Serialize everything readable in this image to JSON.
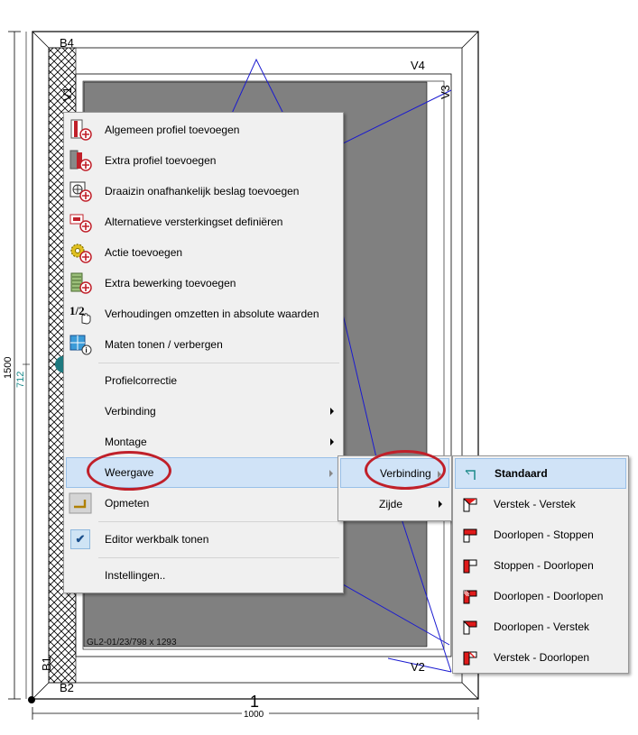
{
  "window_info": {
    "size_label": "GL2-01/23/798 x 1293",
    "corner_labels": {
      "b4": "B4",
      "b2": "B2",
      "b1": "B1",
      "v1": "V1",
      "v2": "V2",
      "v3": "V3",
      "v4": "V4"
    },
    "frame_number": "1"
  },
  "dimensions": {
    "height": "1500",
    "height_sub": "712",
    "width": "1000"
  },
  "context_menu": {
    "items": [
      {
        "label": "Algemeen profiel toevoegen",
        "icon": "profile-add-icon"
      },
      {
        "label": "Extra profiel toevoegen",
        "icon": "extra-profile-add-icon"
      },
      {
        "label": "Draaizin onafhankelijk beslag toevoegen",
        "icon": "hardware-add-icon"
      },
      {
        "label": "Alternatieve versterkingset definiëren",
        "icon": "reinforcement-icon"
      },
      {
        "label": "Actie toevoegen",
        "icon": "action-gear-icon"
      },
      {
        "label": "Extra bewerking toevoegen",
        "icon": "machining-add-icon"
      },
      {
        "label": "Verhoudingen omzetten in absolute waarden",
        "icon": "ratio-hand-icon"
      },
      {
        "label": "Maten tonen / verbergen",
        "icon": "dimensions-toggle-icon"
      },
      {
        "label": "Profielcorrectie"
      },
      {
        "label": "Verbinding"
      },
      {
        "label": "Montage"
      },
      {
        "label": "Weergave"
      },
      {
        "label": "Opmeten",
        "icon": "measure-icon"
      },
      {
        "label": "Editor werkbalk tonen",
        "checked": true
      },
      {
        "label": "Instellingen.."
      }
    ]
  },
  "submenu_weergave": {
    "items": [
      {
        "label": "Verbinding"
      },
      {
        "label": "Zijde"
      }
    ]
  },
  "submenu_verbinding": {
    "items": [
      {
        "label": "Standaard",
        "selected": true
      },
      {
        "label": "Verstek - Verstek"
      },
      {
        "label": "Doorlopen - Stoppen"
      },
      {
        "label": "Stoppen - Doorlopen"
      },
      {
        "label": "Doorlopen - Doorlopen"
      },
      {
        "label": "Doorlopen - Verstek"
      },
      {
        "label": "Verstek - Doorlopen"
      }
    ]
  },
  "colors": {
    "highlight": "#d0e3f7",
    "annotation": "#c0202a",
    "glass": "#808080",
    "sash_lines": "#1a1ad0",
    "dim_sub": "#1a8a8a"
  }
}
